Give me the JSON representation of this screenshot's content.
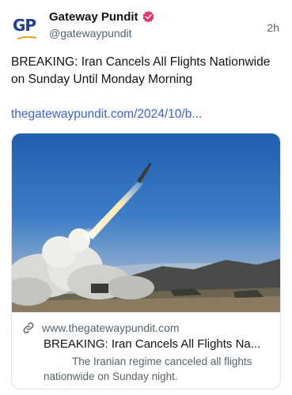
{
  "author": {
    "avatar_text": "GP",
    "display_name": "Gateway Pundit",
    "handle": "@gatewaypundit",
    "timestamp": "2h"
  },
  "post": {
    "text": "BREAKING: Iran Cancels All Flights Nationwide on Sunday Until Monday Morning",
    "link_text": "thegatewaypundit.com/2024/10/b..."
  },
  "card": {
    "domain": "www.thegatewaypundit.com",
    "title": "BREAKING: Iran Cancels All Flights Na...",
    "description": "The Iranian regime canceled all flights nationwide on Sunday night."
  },
  "colors": {
    "link": "#3b62d9",
    "verified_badge": "#e8336d",
    "secondary_text": "#536471"
  },
  "icons": {
    "verified": "verified-badge-icon",
    "link": "link-icon"
  }
}
